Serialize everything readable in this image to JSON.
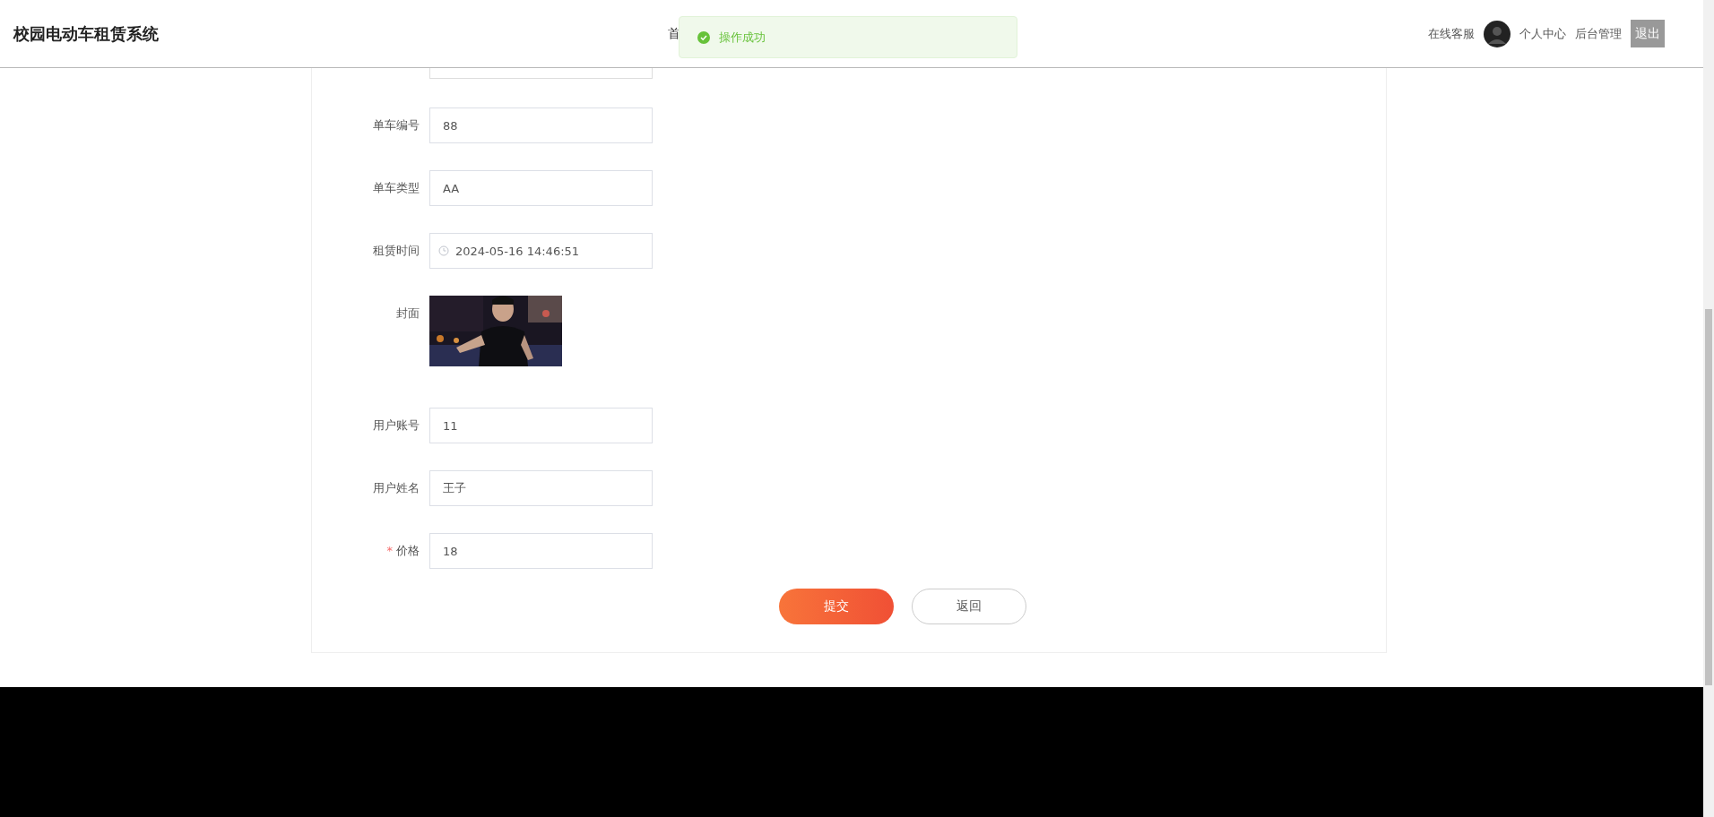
{
  "header": {
    "title": "校园电动车租赁系统",
    "nav": [
      "首"
    ],
    "service_link": "在线客服",
    "user_center_link": "个人中心",
    "admin_link": "后台管理",
    "logout_button": "退出"
  },
  "toast": {
    "kind": "success",
    "message": "操作成功"
  },
  "form": {
    "required_mark": "*",
    "fields": [
      {
        "kind": "text",
        "label": "单车编号",
        "value": "88",
        "required": false
      },
      {
        "kind": "text",
        "label": "单车类型",
        "value": "AA",
        "required": false
      },
      {
        "kind": "datetime",
        "label": "租赁时间",
        "value": "2024-05-16 14:46:51",
        "required": false
      },
      {
        "label": "封面",
        "required": false
      },
      {
        "kind": "text",
        "label": "用户账号",
        "value": "11",
        "required": false
      },
      {
        "kind": "text",
        "label": "用户姓名",
        "value": "王子",
        "required": false
      },
      {
        "kind": "text",
        "label": "价格",
        "value": "18",
        "required": true
      }
    ],
    "buttons": [
      {
        "kind": "primary",
        "label": "提交"
      },
      {
        "kind": "default",
        "label": "返回"
      }
    ]
  }
}
